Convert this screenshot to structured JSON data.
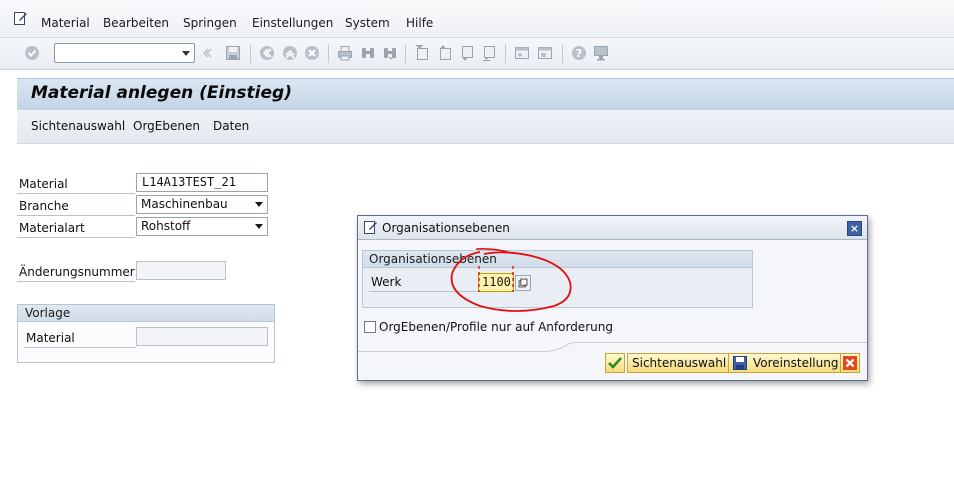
{
  "menubar": {
    "items": [
      "Material",
      "Bearbeiten",
      "Springen",
      "Einstellungen",
      "System",
      "Hilfe"
    ]
  },
  "toolbar": {
    "command_field_value": "",
    "icons": [
      "enter-icon",
      "save-icon",
      "back-icon",
      "exit-icon",
      "cancel-icon",
      "print-icon",
      "find-icon",
      "find-next-icon",
      "first-page-icon",
      "previous-page-icon",
      "next-page-icon",
      "last-page-icon",
      "create-session-icon",
      "shortcut-icon",
      "help-icon",
      "layout-icon"
    ]
  },
  "title": "Material anlegen (Einstieg)",
  "app_toolbar": {
    "buttons": [
      "Sichtenauswahl",
      "OrgEbenen",
      "Daten"
    ]
  },
  "form": {
    "material_label": "Material",
    "material_value": "L14A13TEST_21",
    "branche_label": "Branche",
    "branche_value": "Maschinenbau",
    "materialart_label": "Materialart",
    "materialart_value": "Rohstoff",
    "aenderungsnummer_label": "Änderungsnummer",
    "aenderungsnummer_value": "",
    "vorlage": {
      "header": "Vorlage",
      "material_label": "Material",
      "material_value": ""
    }
  },
  "popup": {
    "title": "Organisationsebenen",
    "group_header": "Organisationsebenen",
    "werk_label": "Werk",
    "werk_value": "1100",
    "checkbox_label": "OrgEbenen/Profile nur auf Anforderung",
    "checkbox_checked": false,
    "buttons": {
      "sichtenauswahl": "Sichtenauswahl",
      "voreinstellung": "Voreinstellung"
    }
  },
  "colors": {
    "title_bar": "#c3d4e6",
    "popup_button": "#f5dc79",
    "werk_field_highlight": "#fff3b0",
    "annotation_red": "#e01010"
  }
}
